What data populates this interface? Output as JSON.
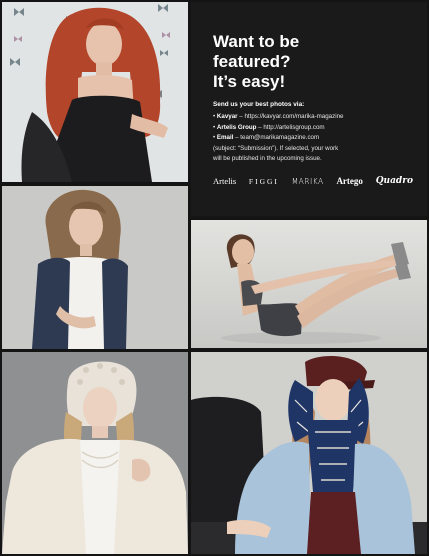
{
  "panel": {
    "headline": [
      "Want to be",
      "featured?",
      "It’s easy!"
    ],
    "send_heading": "Send us your best photos via:",
    "bullet": "•",
    "kavyar_label": "Kavyar",
    "kavyar_value": " – https://kavyar.com/marika-magazine",
    "artelis_label": "Artelis Group",
    "artelis_value": " – http://artelisgroup.com",
    "email_label": "Email",
    "email_value": " – team@marikamagazine.com",
    "note_line1": "(subject: “Submission”). If selected, your work",
    "note_line2": "will be published in the upcoming issue.",
    "brands": [
      "Artelis",
      "FIGGI",
      "MARIKA",
      "Artego",
      "Quadro"
    ]
  },
  "photos": [
    {
      "id": "red-hair-girl-butterflies"
    },
    {
      "id": "girl-denim-vest"
    },
    {
      "id": "girl-v-sit-pose"
    },
    {
      "id": "girl-crochet-hat-fur-coat"
    },
    {
      "id": "girl-cap-scarf-blue-coat"
    }
  ],
  "colors": {
    "background": "#141414",
    "panel": "#1a1a1a",
    "text": "#ffffff"
  }
}
